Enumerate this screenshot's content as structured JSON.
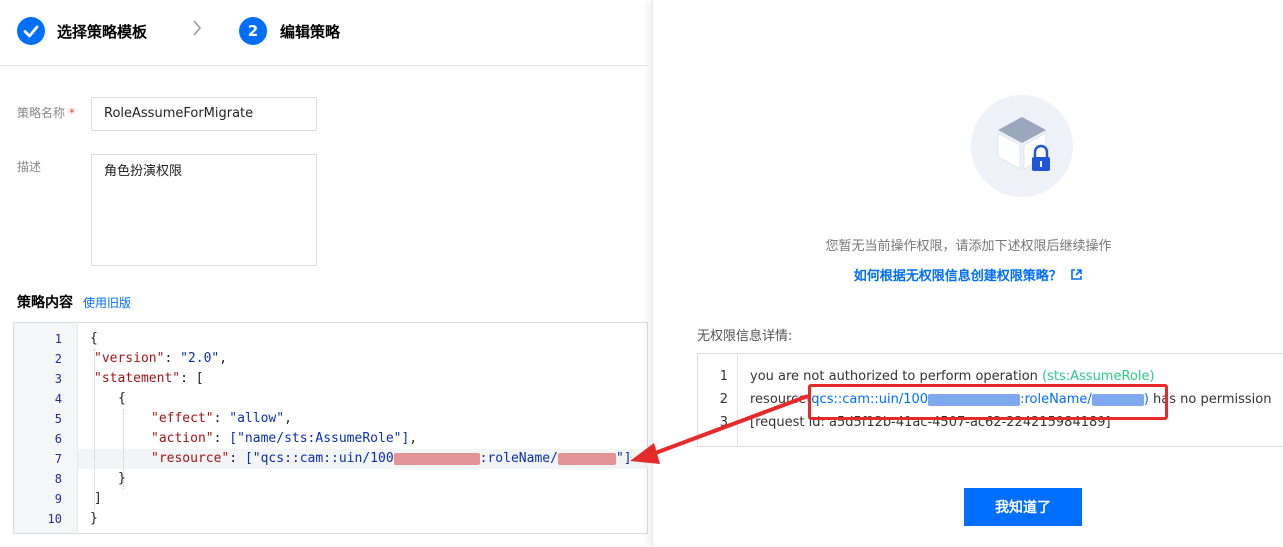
{
  "steps": [
    {
      "label": "选择策略模板",
      "state": "done"
    },
    {
      "label": "编辑策略",
      "number": "2",
      "state": "active"
    }
  ],
  "form": {
    "name_label": "策略名称",
    "required_mark": "*",
    "name_value": "RoleAssumeForMigrate",
    "desc_label": "描述",
    "desc_value": "角色扮演权限"
  },
  "policy": {
    "title": "策略内容",
    "use_old_link": "使用旧版",
    "line_numbers": [
      "1",
      "2",
      "3",
      "4",
      "5",
      "6",
      "7",
      "8",
      "9",
      "10"
    ],
    "lines": {
      "l1": "{",
      "l2_key": "\"version\"",
      "l2_val": "\"2.0\"",
      "l3_key": "\"statement\"",
      "l3_rest": ": [",
      "l4": "{",
      "l5_key": "\"effect\"",
      "l5_val": "\"allow\"",
      "l6_key": "\"action\"",
      "l6_val": "[\"name/sts:AssumeRole\"]",
      "l7_key": "\"resource\"",
      "l7_val_start": "[\"qcs::cam::uin/100",
      "l7_val_mid": ":roleName/",
      "l7_val_end": "\"]",
      "l8": "}",
      "l9": "]",
      "l10": "}"
    }
  },
  "no_permission": {
    "message": "您暂无当前操作权限，请添加下述权限后继续操作",
    "help_link": "如何根据无权限信息创建权限策略？",
    "detail_title": "无权限信息详情:",
    "detail_line_numbers": [
      "1",
      "2",
      "3"
    ],
    "line1_prefix": "you are not authorized to perform operation ",
    "line1_action": "(sts:AssumeRole)",
    "line2_prefix": "resource",
    "line2_resource_a": "(qcs::cam::uin/100",
    "line2_resource_b": ":roleName/",
    "line2_resource_c": ")",
    "line2_suffix": " has no permission",
    "line3": "[request id: a5d5f12b-41ac-4507-ac62-224215984189]",
    "ok_button": "我知道了"
  },
  "colors": {
    "accent": "#006eff",
    "highlight_red": "#e62a2a",
    "action_green": "#29cc85"
  },
  "icons": [
    "check-icon",
    "chevron-right-icon",
    "box-lock-icon",
    "external-link-icon",
    "red-arrow"
  ]
}
